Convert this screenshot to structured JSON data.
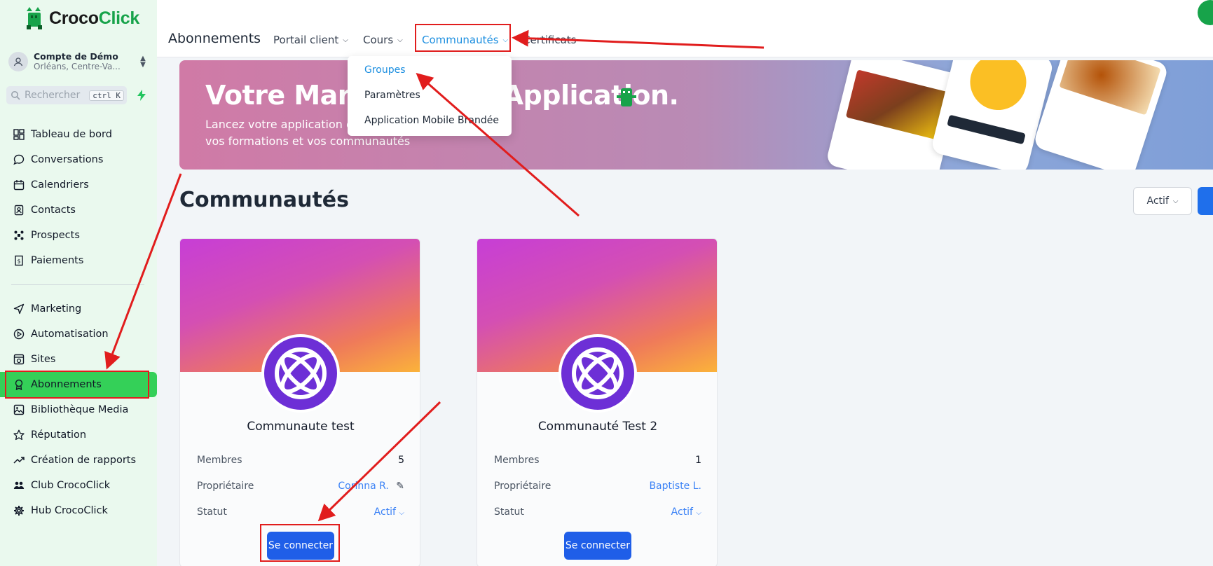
{
  "brand": {
    "part1": "Croco",
    "part2": "Click",
    "green": "#17a34a"
  },
  "account": {
    "name": "Compte de Démo",
    "location": "Orléans, Centre-Va..."
  },
  "search": {
    "placeholder": "Rechercher",
    "shortcut": "ctrl K"
  },
  "sidebar": {
    "active_color": "#34d058",
    "items": [
      {
        "label": "Tableau de bord",
        "icon": "dashboard-icon"
      },
      {
        "label": "Conversations",
        "icon": "chat-icon"
      },
      {
        "label": "Calendriers",
        "icon": "calendar-icon"
      },
      {
        "label": "Contacts",
        "icon": "contacts-icon"
      },
      {
        "label": "Prospects",
        "icon": "prospects-icon"
      },
      {
        "label": "Paiements",
        "icon": "payments-icon"
      },
      {
        "label": "Marketing",
        "icon": "send-icon"
      },
      {
        "label": "Automatisation",
        "icon": "automation-icon"
      },
      {
        "label": "Sites",
        "icon": "sites-icon"
      },
      {
        "label": "Abonnements",
        "icon": "award-icon"
      },
      {
        "label": "Bibliothèque Media",
        "icon": "image-icon"
      },
      {
        "label": "Réputation",
        "icon": "star-icon"
      },
      {
        "label": "Création de rapports",
        "icon": "trending-icon"
      },
      {
        "label": "Club CrocoClick",
        "icon": "users-icon"
      },
      {
        "label": "Hub CrocoClick",
        "icon": "gear-icon"
      }
    ]
  },
  "topbar": {
    "title": "Abonnements",
    "menus": [
      "Portail client",
      "Cours",
      "Communautés",
      "Certificats"
    ],
    "active_color": "#1d8fe0"
  },
  "dropdown": {
    "items": [
      "Groupes",
      "Paramètres",
      "Application Mobile Brandée"
    ]
  },
  "banner": {
    "title": "Votre Marque Votre Application.",
    "subtitle_line1": "Lancez votre application en marque blanche pour",
    "subtitle_line2": "vos formations et vos communautés"
  },
  "section": {
    "title": "Communautés",
    "filter": "Actif"
  },
  "cards": [
    {
      "title": "Communaute test",
      "members_label": "Membres",
      "members": "5",
      "owner_label": "Propriétaire",
      "owner": "Corinna R.",
      "status_label": "Statut",
      "status": "Actif",
      "button": "Se connecter"
    },
    {
      "title": "Communauté Test 2",
      "members_label": "Membres",
      "members": "1",
      "owner_label": "Propriétaire",
      "owner": "Baptiste L.",
      "status_label": "Statut",
      "status": "Actif",
      "button": "Se connecter"
    }
  ]
}
